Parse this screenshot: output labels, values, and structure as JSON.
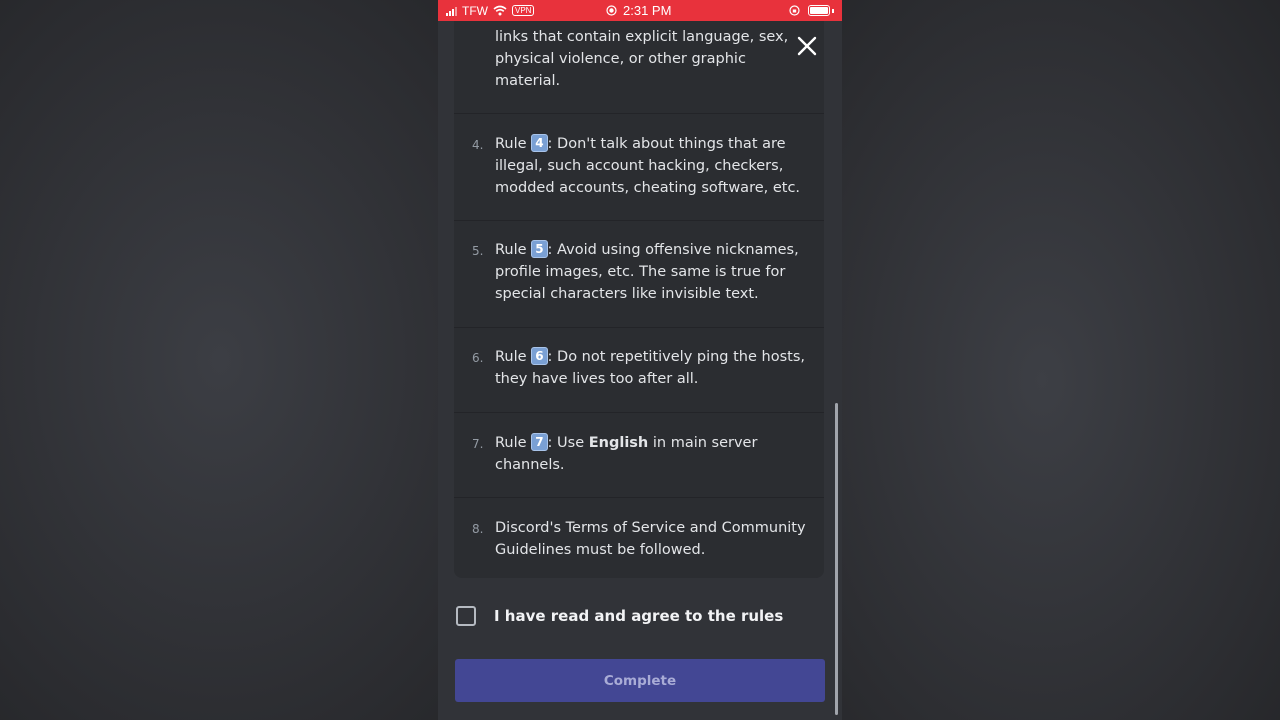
{
  "status_bar": {
    "carrier": "TFW",
    "vpn": "VPN",
    "time": "2:31 PM"
  },
  "rules": [
    {
      "number": "",
      "parts": [
        "links that contain explicit language, sex, physical violence, or other graphic material."
      ]
    },
    {
      "number": "4.",
      "prefix": "Rule ",
      "badge": "4",
      "suffix": ": Don't talk about things that are illegal, such account hacking, checkers, modded accounts, cheating software, etc."
    },
    {
      "number": "5.",
      "prefix": "Rule ",
      "badge": "5",
      "suffix": ": Avoid using offensive nicknames, profile images, etc. The same is true for special characters like invisible text."
    },
    {
      "number": "6.",
      "prefix": "Rule ",
      "badge": "6",
      "suffix": ": Do not repetitively ping the hosts, they have lives too after all."
    },
    {
      "number": "7.",
      "prefix": "Rule ",
      "badge": "7",
      "suffix_before_bold": ": Use ",
      "bold": "English",
      "suffix_after_bold": " in main server channels."
    },
    {
      "number": "8.",
      "text": "Discord's Terms of Service and Community Guidelines must be followed."
    }
  ],
  "agree": {
    "label": "I have read and agree to the rules",
    "checked": false
  },
  "complete_button": {
    "label": "Complete"
  },
  "colors": {
    "accent": "#434794",
    "status_bar": "#e8323c",
    "background": "#313338",
    "card": "#2b2d31"
  },
  "icons": {
    "close": "close-icon",
    "checkbox": "checkbox-icon"
  }
}
